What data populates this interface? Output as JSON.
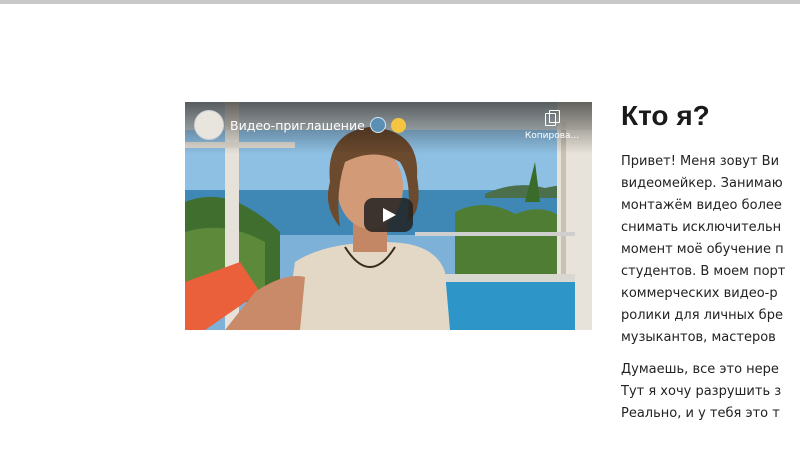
{
  "video": {
    "title": "Видео-приглашение",
    "copy_label": "Копирова..."
  },
  "about": {
    "heading": "Кто я?",
    "paragraph1": [
      "Привет! Меня зовут Ви",
      "видеомейкер. Занимаю",
      "монтажём видео более",
      "снимать исключительн",
      "момент моё обучение п",
      "студентов. В моем порт",
      "коммерческих видео-р",
      "ролики для личных бре",
      "музыкантов, мастеров"
    ],
    "paragraph2": [
      "Думаешь, все это нере",
      "Тут я хочу разрушить з",
      "Реально, и у тебя это т"
    ]
  }
}
